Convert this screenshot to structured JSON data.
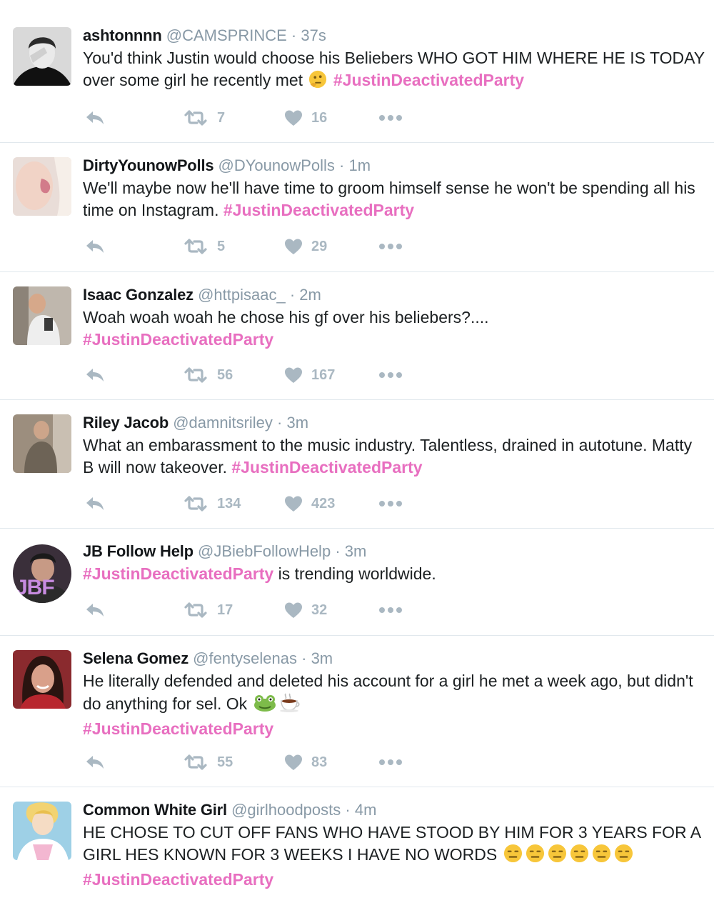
{
  "tweets": [
    {
      "name": "ashtonnnn",
      "handle": "@CAMSPRINCE",
      "time": "37s",
      "text": "You'd think Justin would choose his Beliebers WHO GOT HIM WHERE HE IS TODAY over some girl he recently met",
      "emoji": "thinking-face",
      "hashtag": "#JustinDeactivatedParty",
      "retweets": "7",
      "likes": "16"
    },
    {
      "name": "DirtyYounowPolls",
      "handle": "@DYounowPolls",
      "time": "1m",
      "text": "We'll maybe now he'll have time to groom himself sense he won't be spending all his time on Instagram.",
      "hashtag": "#JustinDeactivatedParty",
      "retweets": "5",
      "likes": "29"
    },
    {
      "name": "Isaac Gonzalez",
      "handle": "@httpisaac_",
      "time": "2m",
      "text": "Woah woah woah he chose his gf over his beliebers?....",
      "hashtag": "#JustinDeactivatedParty",
      "retweets": "56",
      "likes": "167"
    },
    {
      "name": "Riley Jacob",
      "handle": "@damnitsriley",
      "time": "3m",
      "text": "What an embarassment to the music industry. Talentless, drained in autotune. Matty B will now takeover.",
      "hashtag": "#JustinDeactivatedParty",
      "retweets": "134",
      "likes": "423"
    },
    {
      "name": "JB Follow Help",
      "handle": "@JBiebFollowHelp",
      "time": "3m",
      "hashtag": "#JustinDeactivatedParty",
      "text": "is trending worldwide.",
      "avatar_text": "JBF",
      "retweets": "17",
      "likes": "32"
    },
    {
      "name": "Selena Gomez",
      "handle": "@fentyselenas",
      "time": "3m",
      "text": "He literally defended and deleted his account for a girl he met a week ago, but didn't do anything for sel. Ok",
      "emoji": "frog-face, hot-beverage",
      "hashtag": "#JustinDeactivatedParty",
      "retweets": "55",
      "likes": "83"
    },
    {
      "name": "Common White Girl",
      "handle": "@girlhoodposts",
      "time": "4m",
      "text": "HE CHOSE TO CUT OFF FANS WHO HAVE STOOD BY HIM FOR 3 YEARS FOR A GIRL HES KNOWN FOR 3 WEEKS I HAVE NO WORDS",
      "emoji": "expressionless-face x6",
      "hashtag": "#JustinDeactivatedParty"
    }
  ],
  "separator": "·",
  "colors": {
    "hashtag": "#e86fc0",
    "meta": "#8899a6",
    "action": "#aab8c2",
    "divider": "#e1e8ed"
  }
}
